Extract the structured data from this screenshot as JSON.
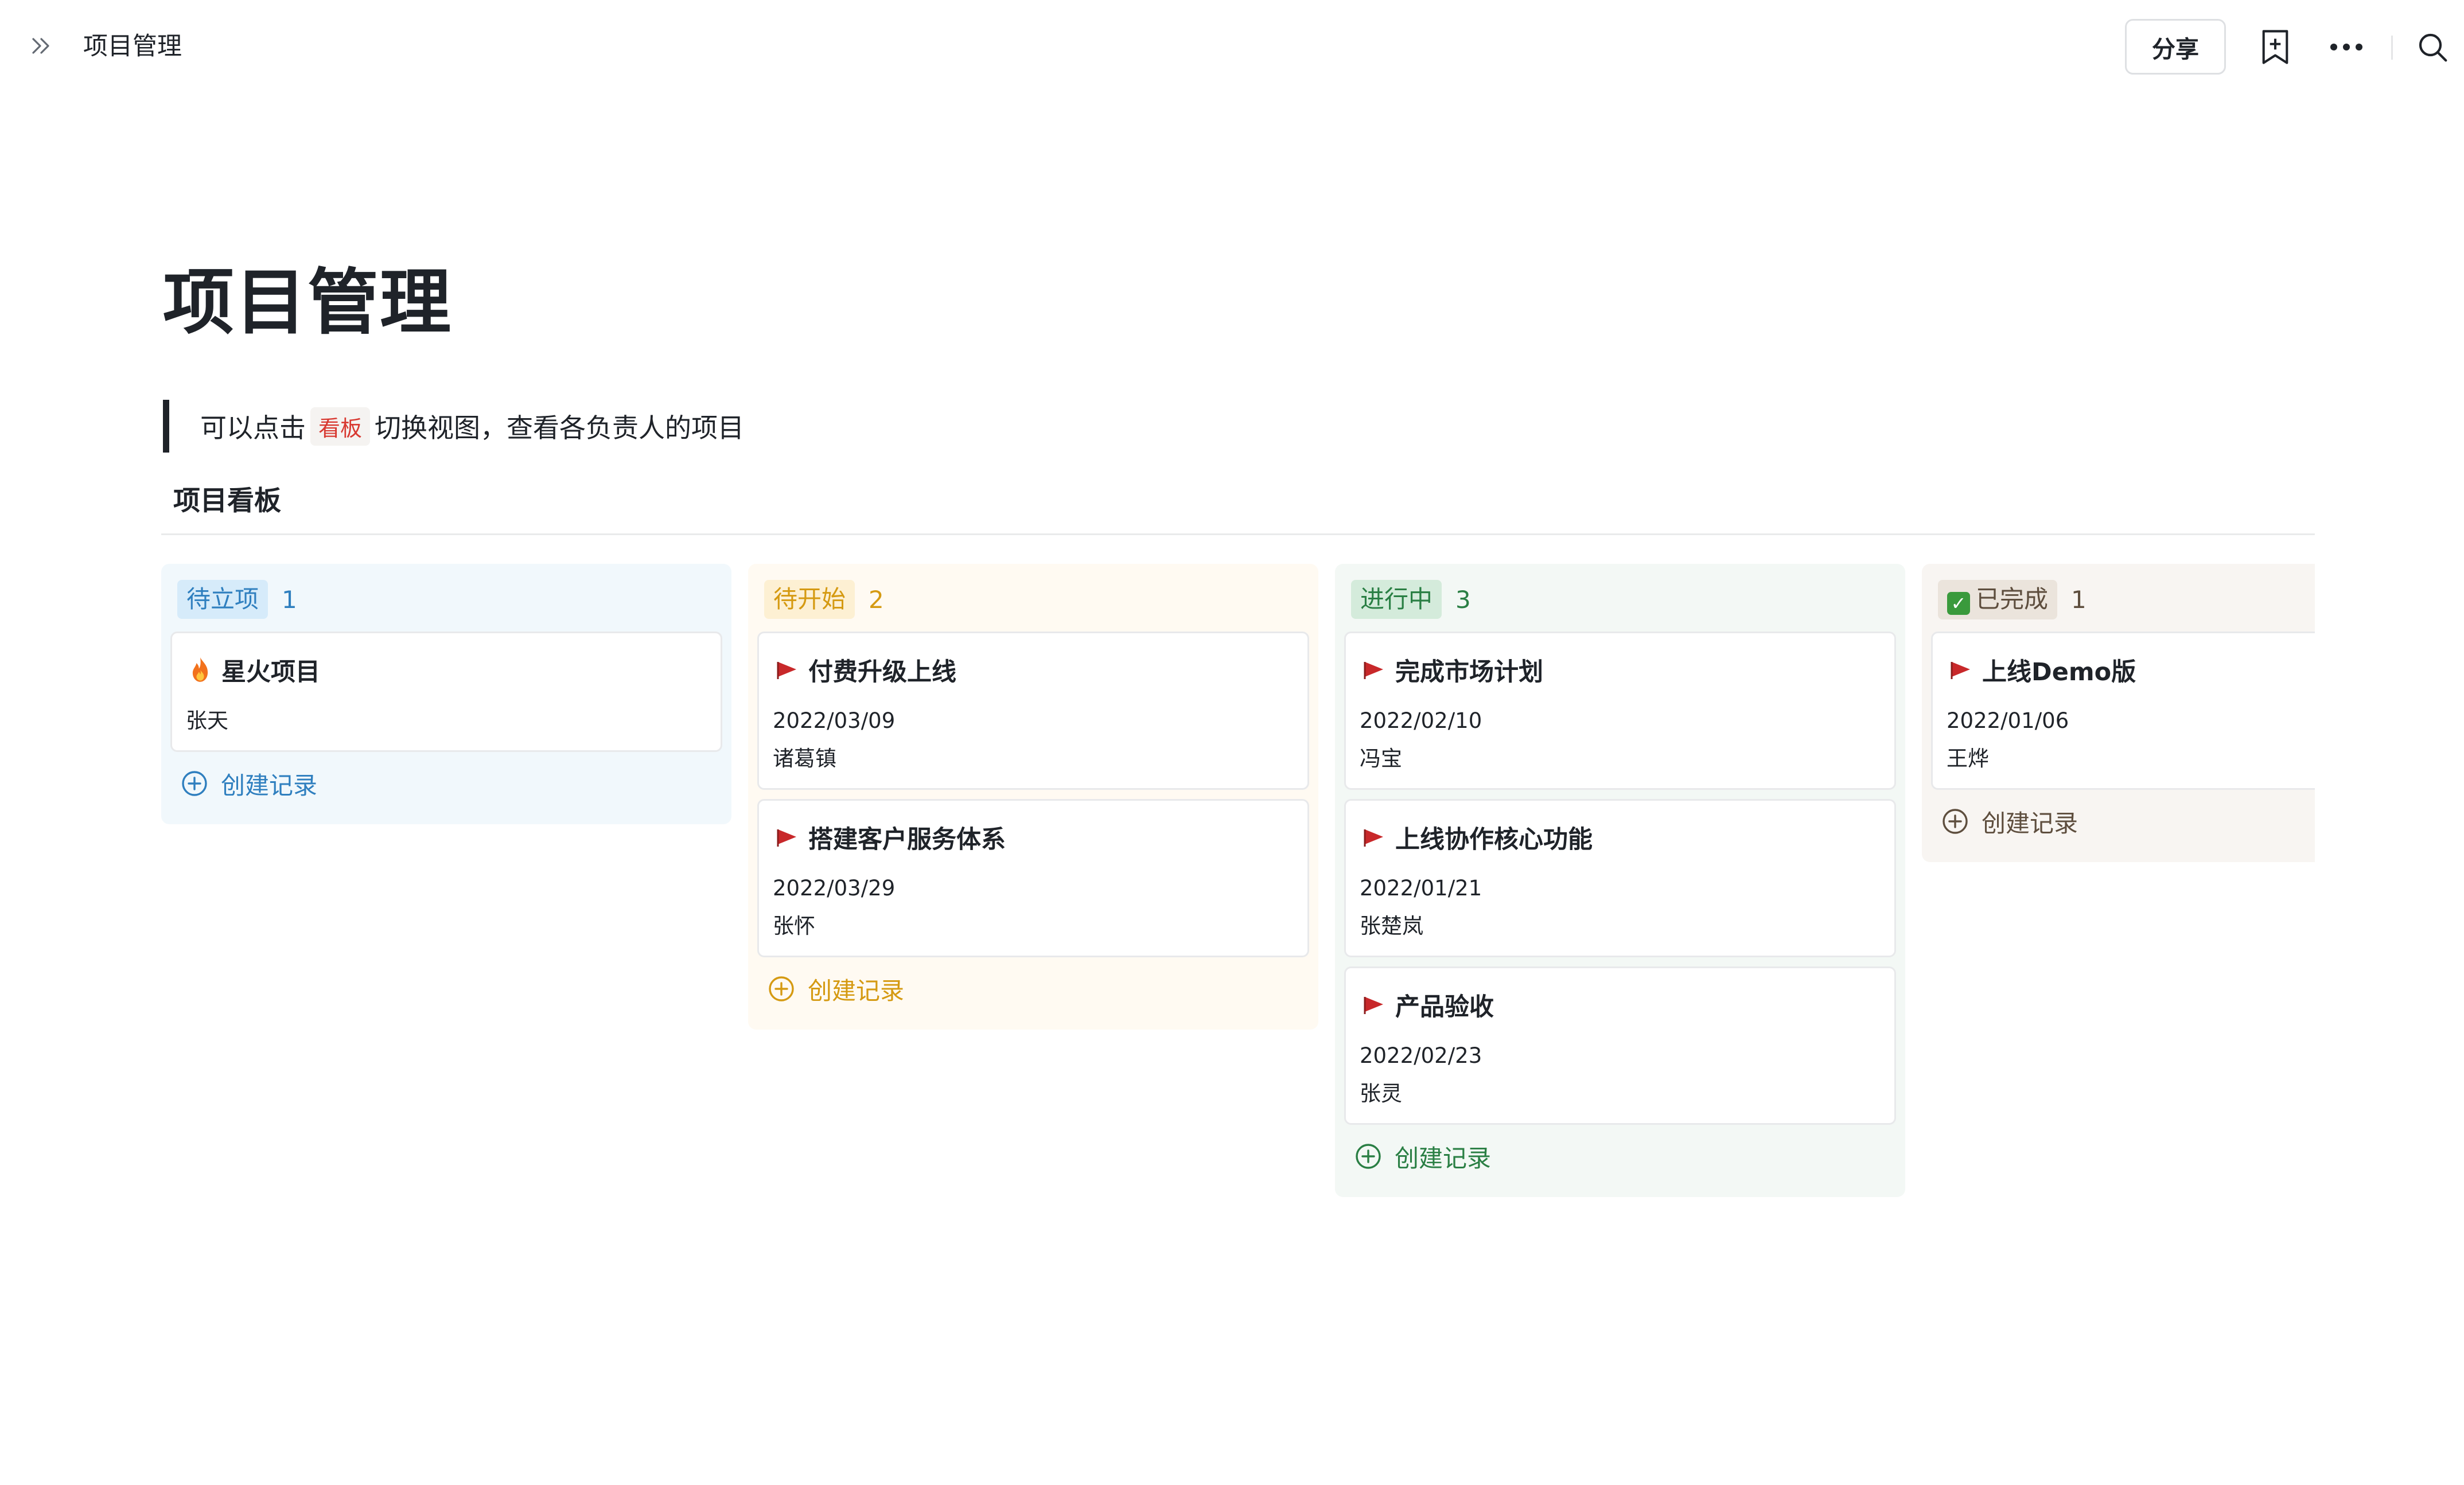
{
  "topbar": {
    "expand_icon": "chevrons-right-icon",
    "breadcrumb_title": "项目管理",
    "share_label": "分享",
    "icons": [
      "add-page-icon",
      "more-icon",
      "search-icon"
    ]
  },
  "page": {
    "title": "项目管理",
    "quote": {
      "before": "可以点击",
      "code": "看板",
      "after": "切换视图，查看各负责人的项目"
    },
    "board_name": "项目看板"
  },
  "board": {
    "add_record_label": "创建记录",
    "columns": [
      {
        "status": "待立项",
        "count": "1",
        "colors": {
          "bg": "#f1f8fc",
          "tag_bg": "#d6ebfa",
          "tag_fg": "#2f7fbf",
          "accent": "#2f7fbf"
        },
        "cards": [
          {
            "icon": "fire-icon",
            "title": "星火项目",
            "date": "",
            "owner": "张天"
          }
        ]
      },
      {
        "status": "待开始",
        "count": "2",
        "colors": {
          "bg": "#fffaf2",
          "tag_bg": "#fdf0d3",
          "tag_fg": "#d59a12",
          "accent": "#d59a12"
        },
        "cards": [
          {
            "icon": "red-flag-icon",
            "title": "付费升级上线",
            "date": "2022/03/09",
            "owner": "诸葛镇"
          },
          {
            "icon": "red-flag-icon",
            "title": "搭建客户服务体系",
            "date": "2022/03/29",
            "owner": "张怀"
          }
        ]
      },
      {
        "status": "进行中",
        "count": "3",
        "colors": {
          "bg": "#f3f8f5",
          "tag_bg": "#d4ebdb",
          "tag_fg": "#2a7f44",
          "accent": "#2a7f44"
        },
        "cards": [
          {
            "icon": "red-flag-icon",
            "title": "完成市场计划",
            "date": "2022/02/10",
            "owner": "冯宝"
          },
          {
            "icon": "red-flag-icon",
            "title": "上线协作核心功能",
            "date": "2022/01/21",
            "owner": "张楚岚"
          },
          {
            "icon": "red-flag-icon",
            "title": "产品验收",
            "date": "2022/02/23",
            "owner": "张灵"
          }
        ]
      },
      {
        "status": "已完成",
        "status_icon": "check-box-icon",
        "count": "1",
        "colors": {
          "bg": "#f8f5f2",
          "tag_bg": "#ebe4dc",
          "tag_fg": "#5e4e3e",
          "accent": "#5e4e3e"
        },
        "cards": [
          {
            "icon": "red-flag-icon",
            "title": "上线Demo版",
            "date": "2022/01/06",
            "owner": "王烨"
          }
        ]
      }
    ]
  }
}
